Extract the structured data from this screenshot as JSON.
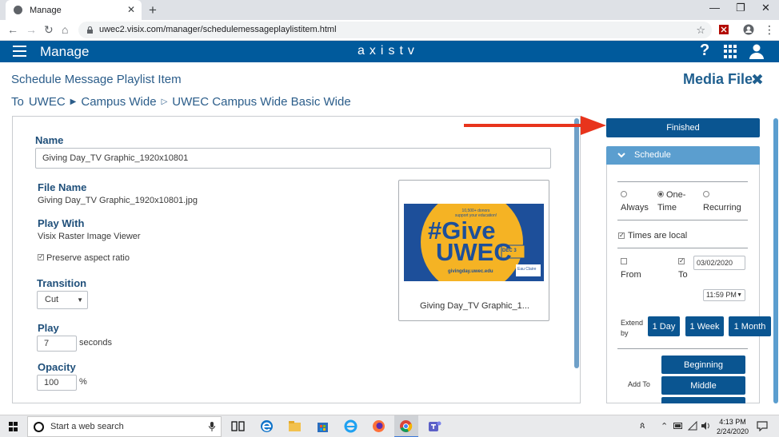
{
  "browser": {
    "tab_title": "Manage",
    "tab_close": "✕",
    "new_tab": "+",
    "url": "uwec2.visix.com/manager/schedulemessageplaylistitem.html",
    "window_minimize": "—",
    "window_restore": "❐",
    "window_close": "✕",
    "nav_back": "←",
    "nav_forward": "→",
    "nav_reload": "↻",
    "nav_home": "⌂",
    "lock": "🔒",
    "bookmark_star": "☆",
    "menu_dots": "⋮"
  },
  "app": {
    "title": "Manage",
    "brand": "axistv",
    "help": "?"
  },
  "page": {
    "title": "Schedule Message Playlist Item",
    "breadcrumb": {
      "to": "To",
      "items": [
        "UWEC",
        "Campus Wide",
        "UWEC Campus Wide Basic Wide"
      ],
      "sep1": "▶",
      "sep2": "▷"
    },
    "media_file_title": "Media File",
    "media_close": "✖"
  },
  "form": {
    "name_label": "Name",
    "name_value": "Giving Day_TV Graphic_1920x10801",
    "file_name_label": "File Name",
    "file_name_value": "Giving Day_TV Graphic_1920x10801.jpg",
    "play_with_label": "Play With",
    "play_with_value": "Visix Raster Image Viewer",
    "preserve_aspect_label": "Preserve aspect ratio",
    "preserve_aspect_checked": true,
    "transition_label": "Transition",
    "transition_value": "Cut",
    "play_label": "Play",
    "play_value": "7",
    "play_unit": "seconds",
    "opacity_label": "Opacity",
    "opacity_value": "100",
    "opacity_unit": "%"
  },
  "preview": {
    "caption": "Giving Day_TV Graphic_1...",
    "graphic": {
      "top_line1": "10,500+ donors",
      "top_line2": "support your education!",
      "hashtag": "#Give",
      "word": "UWEC",
      "date_badge": "DEC 3",
      "url": "givingday.uwec.edu",
      "logo": "Eau Claire"
    },
    "colors": {
      "navy": "#1d4f9a",
      "gold": "#f5b324"
    }
  },
  "schedule": {
    "finished_label": "Finished",
    "header": "Schedule",
    "chevron": "⌄",
    "recurrence": {
      "always": "Always",
      "one_time_line1": "One-",
      "one_time_line2": "Time",
      "recurring": "Recurring",
      "selected": "one_time"
    },
    "times_local_label": "Times are local",
    "times_local_checked": true,
    "from_label": "From",
    "from_checked": false,
    "to_label": "To",
    "to_checked": true,
    "to_date": "03/02/2020",
    "to_time": "11:59 PM",
    "extend_label_line1": "Extend",
    "extend_label_line2": "by",
    "extend_buttons": [
      "1 Day",
      "1 Week",
      "1 Month"
    ],
    "add_to_label": "Add To",
    "add_to_buttons": [
      "Beginning",
      "Middle"
    ]
  },
  "taskbar": {
    "search_placeholder": "Start a web search",
    "time": "4:13 PM",
    "date": "2/24/2020"
  },
  "colors": {
    "app_header": "#005a9c",
    "button": "#0a5591",
    "schedule_header": "#5b9ecf",
    "label": "#1f4f7a",
    "arrow": "#e8341c"
  }
}
